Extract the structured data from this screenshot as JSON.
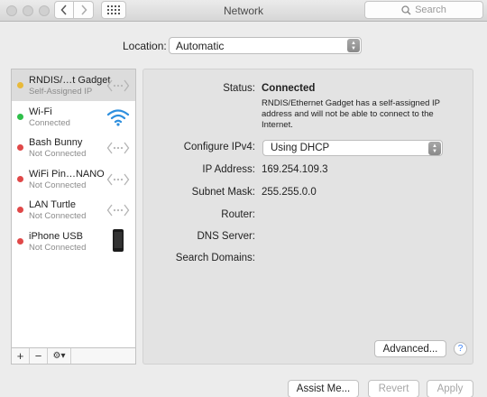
{
  "window": {
    "title": "Network"
  },
  "toolbar": {
    "search_placeholder": "Search"
  },
  "location": {
    "label": "Location:",
    "value": "Automatic"
  },
  "services": [
    {
      "name": "RNDIS/…t Gadget",
      "status": "Self-Assigned IP",
      "dot_color": "#e8b93a",
      "icon": "ethernet-icon",
      "selected": true
    },
    {
      "name": "Wi-Fi",
      "status": "Connected",
      "dot_color": "#2fbf4a",
      "icon": "wifi-icon"
    },
    {
      "name": "Bash Bunny",
      "status": "Not Connected",
      "dot_color": "#e04848",
      "icon": "ethernet-icon"
    },
    {
      "name": "WiFi Pin…NANO",
      "status": "Not Connected",
      "dot_color": "#e04848",
      "icon": "ethernet-icon"
    },
    {
      "name": "LAN Turtle",
      "status": "Not Connected",
      "dot_color": "#e04848",
      "icon": "ethernet-icon"
    },
    {
      "name": "iPhone USB",
      "status": "Not Connected",
      "dot_color": "#e04848",
      "icon": "iphone-icon"
    }
  ],
  "sidebar_footer": {
    "add": "+",
    "remove": "−",
    "gear": "⚙▾"
  },
  "detail": {
    "status_label": "Status:",
    "status_value": "Connected",
    "status_description": "RNDIS/Ethernet Gadget has a self-assigned IP address and will not be able to connect to the Internet.",
    "configure_label": "Configure IPv4:",
    "configure_value": "Using DHCP",
    "ip_label": "IP Address:",
    "ip_value": "169.254.109.3",
    "subnet_label": "Subnet Mask:",
    "subnet_value": "255.255.0.0",
    "router_label": "Router:",
    "dns_label": "DNS Server:",
    "search_domains_label": "Search Domains:",
    "advanced_button": "Advanced...",
    "help_button": "?"
  },
  "buttons": {
    "assist": "Assist Me...",
    "revert": "Revert",
    "apply": "Apply"
  }
}
